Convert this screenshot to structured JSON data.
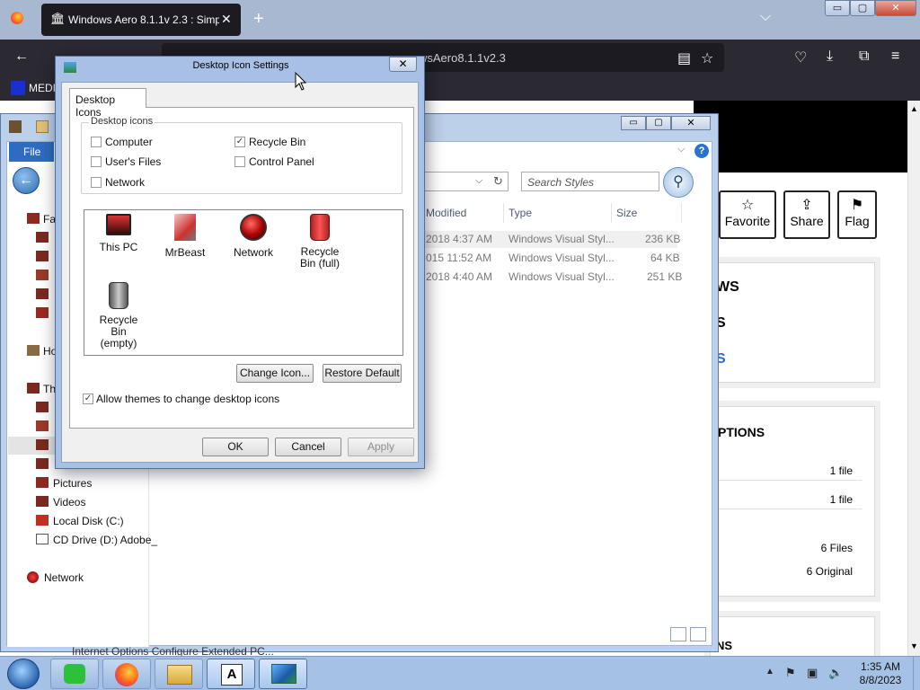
{
  "browser": {
    "tab_title": "Windows Aero 8.1.1v 2.3 : Simp",
    "tab_close": "✕",
    "new_tab": "+",
    "tab_list": "⌵",
    "window_buttons": [
      "▭",
      "▢",
      "✕"
    ],
    "url_fragment": "wsAero8.1.1v2.3",
    "bookmark_label": "MEDI"
  },
  "page": {
    "actions": [
      {
        "glyph": "☆",
        "label": "Favorite"
      },
      {
        "glyph": "⇪",
        "label": "Share"
      },
      {
        "glyph": "⚑",
        "label": "Flag"
      }
    ],
    "headings": [
      "WS",
      "S"
    ],
    "link_fragment": "S",
    "options_heading": "PTIONS",
    "rows": [
      {
        "value": "1 file"
      },
      {
        "value": "1 file"
      },
      {
        "value": "6 Files"
      },
      {
        "value": "6 Original"
      }
    ],
    "bottom_heading": "NS"
  },
  "explorer": {
    "file_tab": "File",
    "search_placeholder": "Search Styles",
    "help": "?",
    "columns": [
      "Modified",
      "Type",
      "Size"
    ],
    "rows": [
      {
        "modified": "2018 4:37 AM",
        "type": "Windows Visual Styl...",
        "size": "236 KB"
      },
      {
        "modified": "015 11:52 AM",
        "type": "Windows Visual Styl...",
        "size": "64 KB"
      },
      {
        "modified": "2018 4:40 AM",
        "type": "Windows Visual Styl...",
        "size": "251 KB"
      }
    ],
    "sidebar": [
      {
        "label": "Fa"
      },
      {
        "label": "Ho"
      },
      {
        "label": "Th"
      },
      {
        "label": "Pictures"
      },
      {
        "label": "Videos"
      },
      {
        "label": "Local Disk (C:)"
      },
      {
        "label": "CD Drive (D:) Adobe_"
      },
      {
        "label": "Network"
      }
    ],
    "bottom_text": "Internet Options Configure Extended PC..."
  },
  "dialog": {
    "title": "Desktop Icon Settings",
    "close": "✕",
    "tab": "Desktop Icons",
    "group_label": "Desktop icons",
    "checkboxes": [
      {
        "label": "Computer",
        "checked": false
      },
      {
        "label": "Recycle Bin",
        "checked": true
      },
      {
        "label": "User's Files",
        "checked": false
      },
      {
        "label": "Control Panel",
        "checked": false
      },
      {
        "label": "Network",
        "checked": false
      }
    ],
    "icons": [
      {
        "label": "This PC",
        "icon": "monitor-icon"
      },
      {
        "label": "MrBeast",
        "icon": "user-folder-icon"
      },
      {
        "label": "Network",
        "icon": "network-globe-icon"
      },
      {
        "label": "Recycle Bin (full)",
        "icon": "recycle-bin-full-icon"
      },
      {
        "label": "Recycle Bin (empty)",
        "icon": "recycle-bin-empty-icon"
      }
    ],
    "change_icon": "Change Icon...",
    "restore_default": "Restore Default",
    "allow_themes": "Allow themes to change desktop icons",
    "allow_themes_checked": true,
    "ok": "OK",
    "cancel": "Cancel",
    "apply": "Apply"
  },
  "taskbar": {
    "apps": [
      "start-orb",
      "app-green",
      "firefox",
      "file-explorer",
      "adobe",
      "display-settings"
    ],
    "time": "1:35 AM",
    "date": "8/8/2023"
  }
}
